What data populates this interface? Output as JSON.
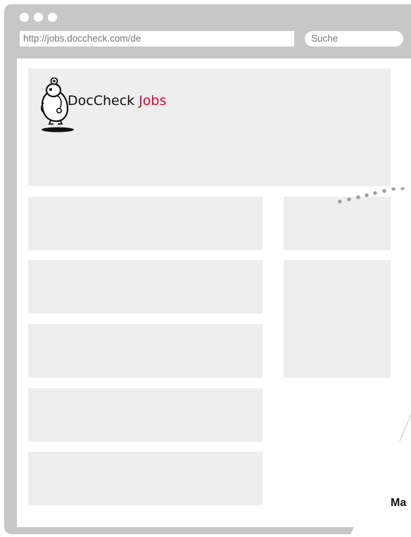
{
  "browser": {
    "url": "http://jobs.doccheck.com/de",
    "search_placeholder": "Suche"
  },
  "logo": {
    "brand": "DocCheck",
    "product": "Jobs"
  },
  "corner_text": "Ma",
  "colors": {
    "frame": "#c7c7c7",
    "placeholder_block": "#eeeeee",
    "brand_red": "#c8102e",
    "dots": "#9e9e9e"
  },
  "icons": [
    "window-control-icon",
    "doccheck-mascot-icon",
    "dotted-connector-icon"
  ]
}
